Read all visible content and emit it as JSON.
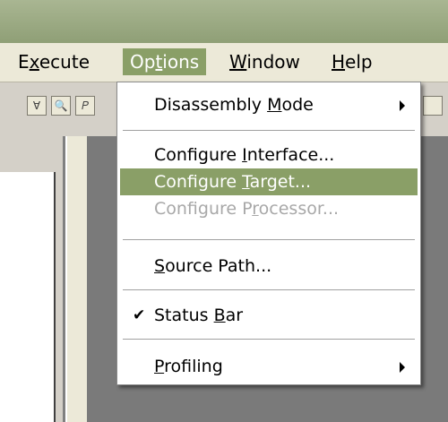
{
  "menubar": {
    "items": [
      {
        "pre": "E",
        "acc": "x",
        "post": "ecute"
      },
      {
        "pre": "Op",
        "acc": "t",
        "post": "ions"
      },
      {
        "pre": "",
        "acc": "W",
        "post": "indow"
      },
      {
        "pre": "",
        "acc": "H",
        "post": "elp"
      }
    ]
  },
  "toolbar": {
    "buttons": [
      "Ɐ",
      "🔍",
      "𝑃"
    ]
  },
  "options_menu": {
    "items": [
      {
        "pre": "Disassembly ",
        "acc": "M",
        "post": "ode"
      },
      {
        "pre": "Configure ",
        "acc": "I",
        "post": "nterface..."
      },
      {
        "pre": "Configure ",
        "acc": "T",
        "post": "arget..."
      },
      {
        "pre": "Configure P",
        "acc": "r",
        "post": "ocessor..."
      },
      {
        "pre": "",
        "acc": "S",
        "post": "ource Path..."
      },
      {
        "pre": "Status ",
        "acc": "B",
        "post": "ar"
      },
      {
        "pre": "",
        "acc": "P",
        "post": "rofiling"
      }
    ],
    "check_glyph": "✔",
    "highlight_color": "#8a9f67"
  }
}
